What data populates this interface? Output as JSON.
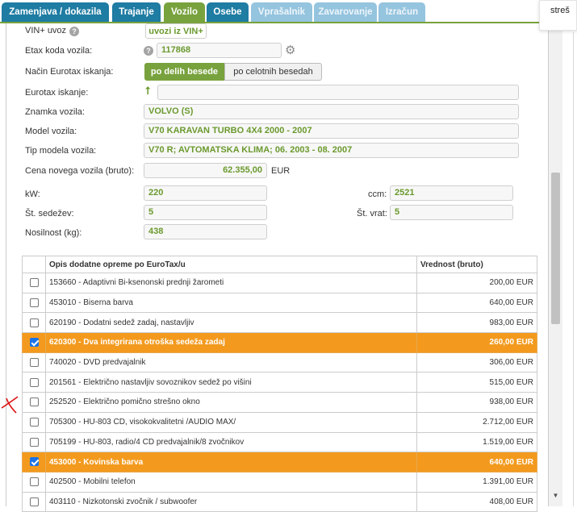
{
  "tabs": [
    {
      "label": "Zamenjava / dokazila",
      "state": "dark"
    },
    {
      "label": "Trajanje",
      "state": "dark"
    },
    {
      "label": "Vozilo",
      "state": "active"
    },
    {
      "label": "Osebe",
      "state": "dark"
    },
    {
      "label": "Vprašalnik",
      "state": "light"
    },
    {
      "label": "Zavarovanje",
      "state": "light"
    },
    {
      "label": "Izračun",
      "state": "light"
    }
  ],
  "popup_text": "streš",
  "form": {
    "vin_label": "VIN+ uvoz",
    "vin_button": "uvozi iz VIN+",
    "etax_label": "Etax koda vozila:",
    "etax_value": "117868",
    "search_mode_label": "Način Eurotax iskanja:",
    "search_mode_on": "po delih besede",
    "search_mode_off": "po celotnih besedah",
    "search_label": "Eurotax iskanje:",
    "search_value": "",
    "brand_label": "Znamka vozila:",
    "brand_value": "VOLVO (S)",
    "model_label": "Model vozila:",
    "model_value": "V70 KARAVAN TURBO 4X4 2000 - 2007",
    "type_label": "Tip modela vozila:",
    "type_value": "V70 R; AVTOMATSKA KLIMA; 06. 2003 - 08. 2007",
    "price_label": "Cena novega vozila (bruto):",
    "price_value": "62.355,00",
    "price_unit": "EUR",
    "kw_label": "kW:",
    "kw_value": "220",
    "ccm_label": "ccm:",
    "ccm_value": "2521",
    "seats_label": "Št. sedežev:",
    "seats_value": "5",
    "doors_label": "Št. vrat:",
    "doors_value": "5",
    "load_label": "Nosilnost (kg):",
    "load_value": "438"
  },
  "table": {
    "col_desc": "Opis dodatne opreme po EuroTax/u",
    "col_value": "Vrednost (bruto)",
    "rows": [
      {
        "desc": "153660 - Adaptivni Bi-ksenonski prednji žarometi",
        "value": "200,00 EUR",
        "checked": false
      },
      {
        "desc": "453010 - Biserna barva",
        "value": "640,00 EUR",
        "checked": false
      },
      {
        "desc": "620190 - Dodatni sedež zadaj, nastavljiv",
        "value": "983,00 EUR",
        "checked": false
      },
      {
        "desc": "620300 - Dva integrirana otroška sedeža zadaj",
        "value": "260,00 EUR",
        "checked": true
      },
      {
        "desc": "740020 - DVD predvajalnik",
        "value": "306,00 EUR",
        "checked": false
      },
      {
        "desc": "201561 - Električno nastavljiv sovoznikov sedež po višini",
        "value": "515,00 EUR",
        "checked": false
      },
      {
        "desc": "252520 - Električno pomično strešno okno",
        "value": "938,00 EUR",
        "checked": false
      },
      {
        "desc": "705300 - HU-803 CD, visokokvalitetni /AUDIO MAX/",
        "value": "2.712,00 EUR",
        "checked": false
      },
      {
        "desc": "705199 - HU-803, radio/4 CD predvajalnik/8 zvočnikov",
        "value": "1.519,00 EUR",
        "checked": false
      },
      {
        "desc": "453000 - Kovinska barva",
        "value": "640,00 EUR",
        "checked": true
      },
      {
        "desc": "402500 - Mobilni telefon",
        "value": "1.391,00 EUR",
        "checked": false
      },
      {
        "desc": "403110 - Nizkotonski zvočnik / subwoofer",
        "value": "408,00 EUR",
        "checked": false
      }
    ]
  },
  "colors": {
    "tab_dark": "#1f7ca3",
    "tab_active": "#78a23d",
    "tab_light": "#95c4de",
    "selected_row": "#f39a1e",
    "value_text": "#6b9a2e",
    "annotation_mark": "#d11"
  }
}
